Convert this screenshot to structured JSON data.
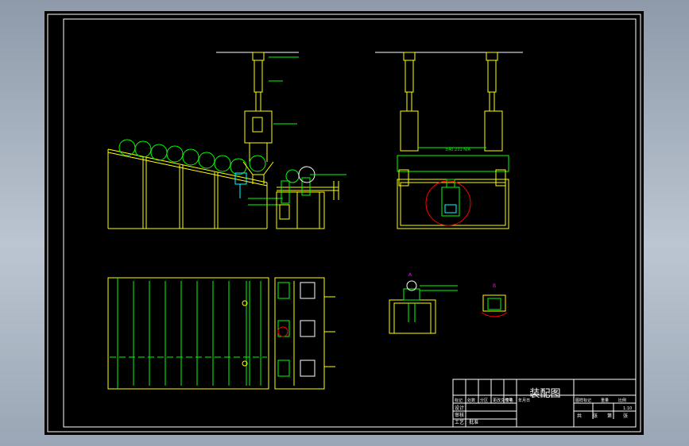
{
  "title_block": {
    "drawing_title": "装配图",
    "row_labels": [
      "设计",
      "审核",
      "工艺",
      "批准"
    ],
    "header_labels": [
      "标记",
      "处数",
      "分区",
      "更改文件号",
      "签名",
      "年月日"
    ],
    "right_header": [
      "图样标记",
      "重量",
      "比例"
    ],
    "scale": "1:10",
    "sheet_info": [
      "共",
      "张",
      "第",
      "张"
    ]
  },
  "annotations": {
    "beam_span": "±40.231 N/A",
    "detail_mark_a": "A",
    "detail_mark_b": "B"
  },
  "colors": {
    "background": "#000000",
    "frame": "#ffffff",
    "lines_main": "#ffff00",
    "lines_secondary": "#00ff00",
    "detail_circle": "#ff0000",
    "annotation": "#ff00ff",
    "hatch_cyan": "#00ffff"
  }
}
